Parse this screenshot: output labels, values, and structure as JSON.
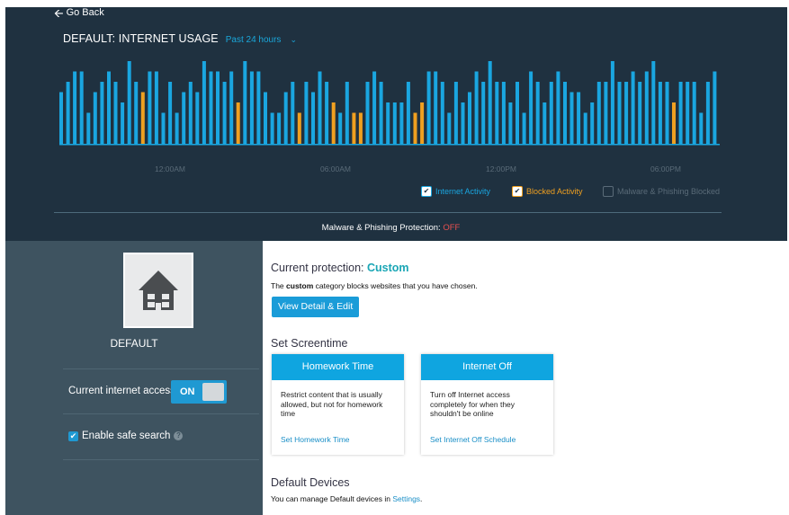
{
  "header": {
    "back_label": "Go Back",
    "title": "DEFAULT: INTERNET USAGE",
    "period": "Past 24 hours"
  },
  "chart_data": {
    "type": "bar",
    "title": "",
    "x_ticks": [
      "12:00AM",
      "06:00AM",
      "12:00PM",
      "06:00PM"
    ],
    "series": [
      {
        "name": "Internet Activity",
        "color": "#1aa6e0",
        "values": [
          5,
          6,
          7,
          7,
          3,
          5,
          6,
          7,
          6,
          4,
          8,
          6,
          3,
          7,
          7,
          3,
          6,
          3,
          5,
          6,
          5,
          8,
          7,
          7,
          6,
          7,
          6,
          8,
          7,
          7,
          5,
          3,
          3,
          5,
          6,
          3,
          6,
          5,
          7,
          6,
          5,
          3,
          6,
          5,
          3,
          6,
          7,
          6,
          4,
          4,
          4,
          6,
          6,
          6,
          7,
          7,
          6,
          3,
          6,
          4,
          5,
          7,
          6,
          8,
          6,
          6,
          4,
          6,
          3,
          7,
          6,
          4,
          6,
          7,
          6,
          5,
          5,
          3,
          4,
          6,
          6,
          8,
          6,
          6,
          7,
          6,
          7,
          8,
          6,
          6,
          4,
          6,
          6,
          6,
          3,
          6,
          7
        ]
      },
      {
        "name": "Blocked Activity",
        "color": "#f0a020",
        "values": [
          0,
          0,
          0,
          0,
          0,
          0,
          0,
          0,
          0,
          0,
          0,
          0,
          5,
          0,
          0,
          0,
          0,
          0,
          0,
          0,
          0,
          0,
          0,
          0,
          0,
          0,
          4,
          0,
          0,
          0,
          0,
          0,
          0,
          0,
          0,
          3,
          0,
          0,
          0,
          0,
          4,
          0,
          0,
          3,
          3,
          0,
          0,
          0,
          0,
          0,
          0,
          0,
          3,
          4,
          0,
          0,
          0,
          0,
          0,
          0,
          0,
          0,
          0,
          0,
          0,
          0,
          0,
          0,
          0,
          0,
          0,
          0,
          0,
          0,
          0,
          0,
          0,
          0,
          0,
          0,
          0,
          0,
          0,
          0,
          0,
          0,
          0,
          0,
          0,
          0,
          4,
          0,
          0,
          0,
          0,
          0,
          0
        ]
      }
    ],
    "legend": [
      {
        "label": "Internet Activity",
        "checked": true,
        "color": "#1aa6e0"
      },
      {
        "label": "Blocked Activity",
        "checked": true,
        "color": "#f0a020"
      },
      {
        "label": "Malware & Phishing Blocked",
        "checked": false,
        "color": "#5a6b78"
      }
    ]
  },
  "malware": {
    "label": "Malware & Phishing Protection:",
    "status": "OFF"
  },
  "profile": {
    "name": "DEFAULT",
    "access_label": "Current internet access",
    "toggle_label": "ON",
    "safe_search_label": "Enable safe search",
    "help_glyph": "?"
  },
  "protection": {
    "heading": "Current protection:",
    "value": "Custom",
    "desc_pre": "The",
    "desc_bold": "custom",
    "desc_post": "category blocks websites that you have chosen.",
    "button": "View Detail & Edit"
  },
  "screentime": {
    "heading": "Set Screentime",
    "cards": [
      {
        "title": "Homework Time",
        "desc": "Restrict content that is usually allowed, but not for homework time",
        "link": "Set Homework Time"
      },
      {
        "title": "Internet Off",
        "desc": "Turn off Internet access completely for when they shouldn't be online",
        "link": "Set Internet Off Schedule"
      }
    ]
  },
  "devices": {
    "heading": "Default Devices",
    "desc_pre": "You can manage Default devices in",
    "link": "Settings",
    "desc_post": "."
  }
}
